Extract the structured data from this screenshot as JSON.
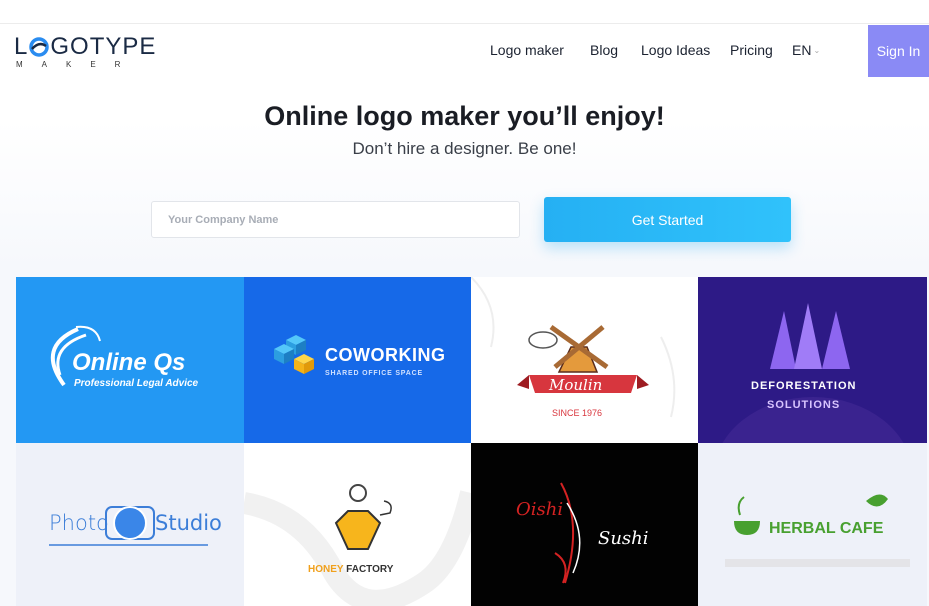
{
  "brand": {
    "name": "LOGOTYPE",
    "name_prefix": "L",
    "name_suffix": "GOTYPE",
    "sub": "MAKER"
  },
  "nav": {
    "items": [
      "Logo maker",
      "Blog",
      "Logo Ideas",
      "Pricing"
    ],
    "language": "EN",
    "signin": "Sign In"
  },
  "hero": {
    "title": "Online logo maker you’ll enjoy!",
    "subtitle": "Don’t hire a designer. Be one!",
    "input_placeholder": "Your Company Name",
    "cta": "Get Started"
  },
  "colors": {
    "accent": "#2aaef5",
    "signin": "#8a8af5"
  },
  "gallery": [
    {
      "name": "Online Qs",
      "tagline": "Professional Legal Advice",
      "bg": "#2398f3"
    },
    {
      "name": "COWORKING",
      "tagline": "SHARED OFFICE SPACE",
      "bg": "#1669e8"
    },
    {
      "name": "Moulin",
      "tagline": "SINCE 1976",
      "bg": "#ffffff"
    },
    {
      "name": "DEFORESTATION",
      "tagline": "SOLUTIONS",
      "bg": "#2d1a86"
    },
    {
      "name": "Photo",
      "tagline": "Studio",
      "bg": "#eef1f9"
    },
    {
      "name": "FACTORY",
      "tagline": "HONEY",
      "bg": "#ffffff"
    },
    {
      "name": "Oishi",
      "tagline": "Sushi",
      "bg": "#020202"
    },
    {
      "name": "HERBAL CAFE",
      "tagline": "",
      "bg": "#eef1f9"
    }
  ]
}
